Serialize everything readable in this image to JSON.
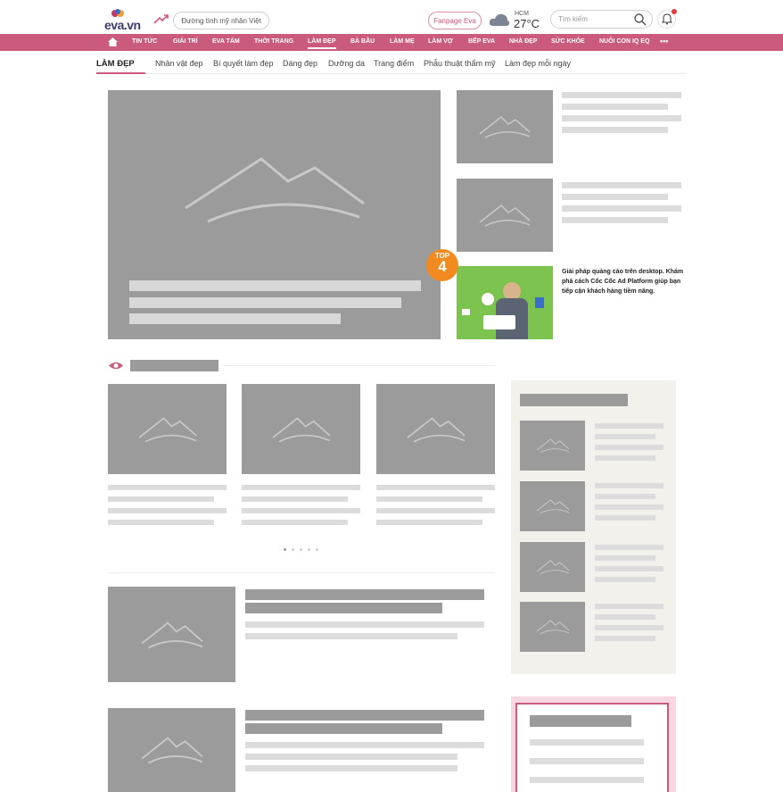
{
  "header": {
    "logo_text": "eva.vn",
    "trending_pill": "Đường tình mỹ nhân Việt",
    "fanpage_pill": "Fanpage Eva",
    "weather_city": "HCM",
    "weather_temp": "27°C",
    "search_placeholder": "Tìm kiếm"
  },
  "nav": {
    "items": [
      "TIN TỨC",
      "GIẢI TRÍ",
      "EVA TÁM",
      "THỜI TRANG",
      "LÀM ĐẸP",
      "BÀ BẦU",
      "LÀM MẸ",
      "LÀM VỢ",
      "BẾP EVA",
      "NHÀ ĐẸP",
      "SỨC KHỎE",
      "NUÔI CON IQ EQ"
    ],
    "more": "•••",
    "active": "LÀM ĐẸP"
  },
  "subnav": {
    "items": [
      "LÀM ĐẸP",
      "Nhân vật đẹp",
      "Bí quyết làm đẹp",
      "Dáng đẹp",
      "Dưỡng da",
      "Trang điểm",
      "Phẫu thuật thẩm mỹ",
      "Làm đẹp mỗi ngày"
    ]
  },
  "ad": {
    "badge_top": "TOP",
    "badge_num": "4",
    "text": "Giải pháp quảng cáo trên desktop. Khám phá cách Cốc Cốc Ad Platform giúp bạn tiếp cận khách hàng tiềm năng."
  },
  "colors": {
    "brand_pink": "#cb5b7c",
    "placeholder_gray": "#9b9b9b",
    "ad_green": "#7cc34f",
    "badge_orange": "#f18a1f"
  },
  "icons": [
    "home-icon",
    "trend-icon",
    "cloud-icon",
    "search-icon",
    "bell-icon",
    "eye-icon",
    "mountain-placeholder-icon"
  ]
}
